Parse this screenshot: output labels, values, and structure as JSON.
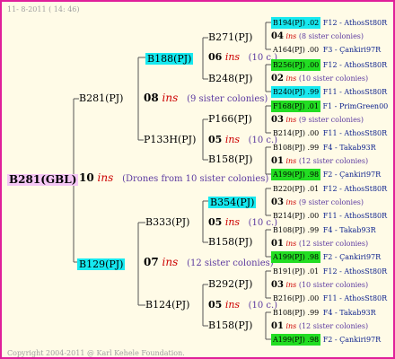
{
  "header": {
    "date": "11-  8-2011 ( 14: 46)"
  },
  "footer": {
    "copyright": "Copyright 2004-2011 @ Karl Kehele Foundation."
  },
  "root": {
    "name": "B281(GBL)",
    "gen": "10",
    "ins": "ins",
    "note": "(Drones from 10 sister colonies)"
  },
  "g2": {
    "top": {
      "name": "B281(PJ)",
      "gen": "08",
      "ins": "ins",
      "note": "(9 sister colonies)"
    },
    "bot": {
      "name": "B129(PJ)",
      "gen": "07",
      "ins": "ins",
      "note": "(12 sister colonies)"
    }
  },
  "g3": {
    "a": {
      "name": "B188(PJ)",
      "gen": "06",
      "ins": "ins",
      "note": "(10 c.)"
    },
    "b": {
      "name": "P133H(PJ)",
      "gen": "05",
      "ins": "ins",
      "note": "(10 c.)"
    },
    "c": {
      "name": "B333(PJ)",
      "gen": "05",
      "ins": "ins",
      "note": "(10 c.)"
    },
    "d": {
      "name": "B124(PJ)",
      "gen": "05",
      "ins": "ins",
      "note": "(10 c.)"
    }
  },
  "g4": {
    "a1": "B271(PJ)",
    "a2": "B248(PJ)",
    "b1": "P166(PJ)",
    "b2": "B158(PJ)",
    "c1": "B354(PJ)",
    "c2": "B158(PJ)",
    "d1": "B292(PJ)",
    "d2": "B158(PJ)"
  },
  "g5": [
    {
      "top": "B194(PJ) .02",
      "top_src": "F12 - AthosSt80R",
      "mid_gen": "04",
      "mid_note": "(8 sister colonies)",
      "bot": "A164(PJ) .00",
      "bot_src": "F3 - Çankiri97R"
    },
    {
      "top": "B256(PJ) .00",
      "top_src": "F12 - AthosSt80R",
      "mid_gen": "02",
      "mid_note": "(10 sister colonies)",
      "bot": "B240(PJ) .99",
      "bot_src": "F11 - AthosSt80R"
    },
    {
      "top": "F168(PJ) .01",
      "top_src": "F1 - PrimGreen00",
      "mid_gen": "03",
      "mid_note": "(9 sister colonies)",
      "bot": "B214(PJ) .00",
      "bot_src": "F11 - AthosSt80R"
    },
    {
      "top": "B108(PJ) .99",
      "top_src": "F4 - Takab93R",
      "mid_gen": "01",
      "mid_note": "(12 sister colonies)",
      "bot": "A199(PJ) .98",
      "bot_src": "F2 - Çankiri97R"
    },
    {
      "top": "B220(PJ) .01",
      "top_src": "F12 - AthosSt80R",
      "mid_gen": "03",
      "mid_note": "(9 sister colonies)",
      "bot": "B214(PJ) .00",
      "bot_src": "F11 - AthosSt80R"
    },
    {
      "top": "B108(PJ) .99",
      "top_src": "F4 - Takab93R",
      "mid_gen": "01",
      "mid_note": "(12 sister colonies)",
      "bot": "A199(PJ) .98",
      "bot_src": "F2 - Çankiri97R"
    },
    {
      "top": "B191(PJ) .01",
      "top_src": "F12 - AthosSt80R",
      "mid_gen": "03",
      "mid_note": "(10 sister colonies)",
      "bot": "B216(PJ) .00",
      "bot_src": "F11 - AthosSt80R"
    },
    {
      "top": "B108(PJ) .99",
      "top_src": "F4 - Takab93R",
      "mid_gen": "01",
      "mid_note": "(12 sister colonies)",
      "bot": "A199(PJ) .98",
      "bot_src": "F2 - Çankiri97R"
    }
  ],
  "ins_label": "ins"
}
